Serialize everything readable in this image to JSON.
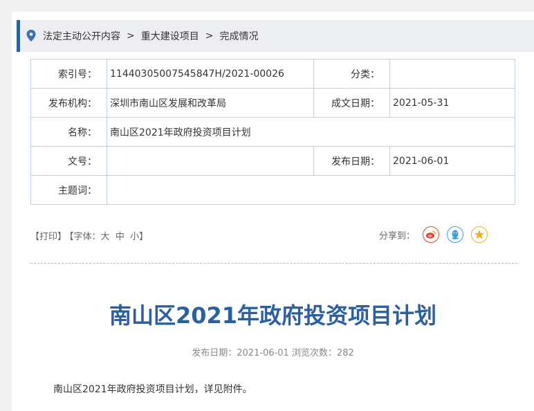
{
  "breadcrumb": {
    "items": [
      "法定主动公开内容",
      "重大建设项目",
      "完成情况"
    ],
    "separator": ">"
  },
  "meta": {
    "index_label": "索引号：",
    "index_value": "11440305007545847H/2021-00026",
    "category_label": "分类：",
    "category_value": "",
    "publisher_label": "发布机构：",
    "publisher_value": "深圳市南山区发展和改革局",
    "written_date_label": "成文日期：",
    "written_date_value": "2021-05-31",
    "name_label": "名称：",
    "name_value": "南山区2021年政府投资项目计划",
    "docno_label": "文号：",
    "docno_value": "",
    "publish_date_label": "发布日期：",
    "publish_date_value": "2021-06-01",
    "subject_label": "主题词：",
    "subject_value": ""
  },
  "tools": {
    "print": "【打印】",
    "font_prefix": "【字体：",
    "font_large": "大",
    "font_medium": "中",
    "font_small": "小",
    "font_suffix": "】"
  },
  "share": {
    "label": "分享到：",
    "icons": [
      "weibo-icon",
      "qq-icon",
      "qzone-icon"
    ],
    "colors": {
      "weibo": "#e6462c",
      "qq": "#3a9ee0",
      "qzone": "#f1b21c"
    }
  },
  "article": {
    "title": "南山区2021年政府投资项目计划",
    "publish_info": "发布日期：2021-06-01  浏览次数：282",
    "body": "南山区2021年政府投资项目计划，详见附件。"
  },
  "colors": {
    "accent": "#2a62a6",
    "title": "#2a5fa2",
    "table_border": "#bcd0e0"
  }
}
